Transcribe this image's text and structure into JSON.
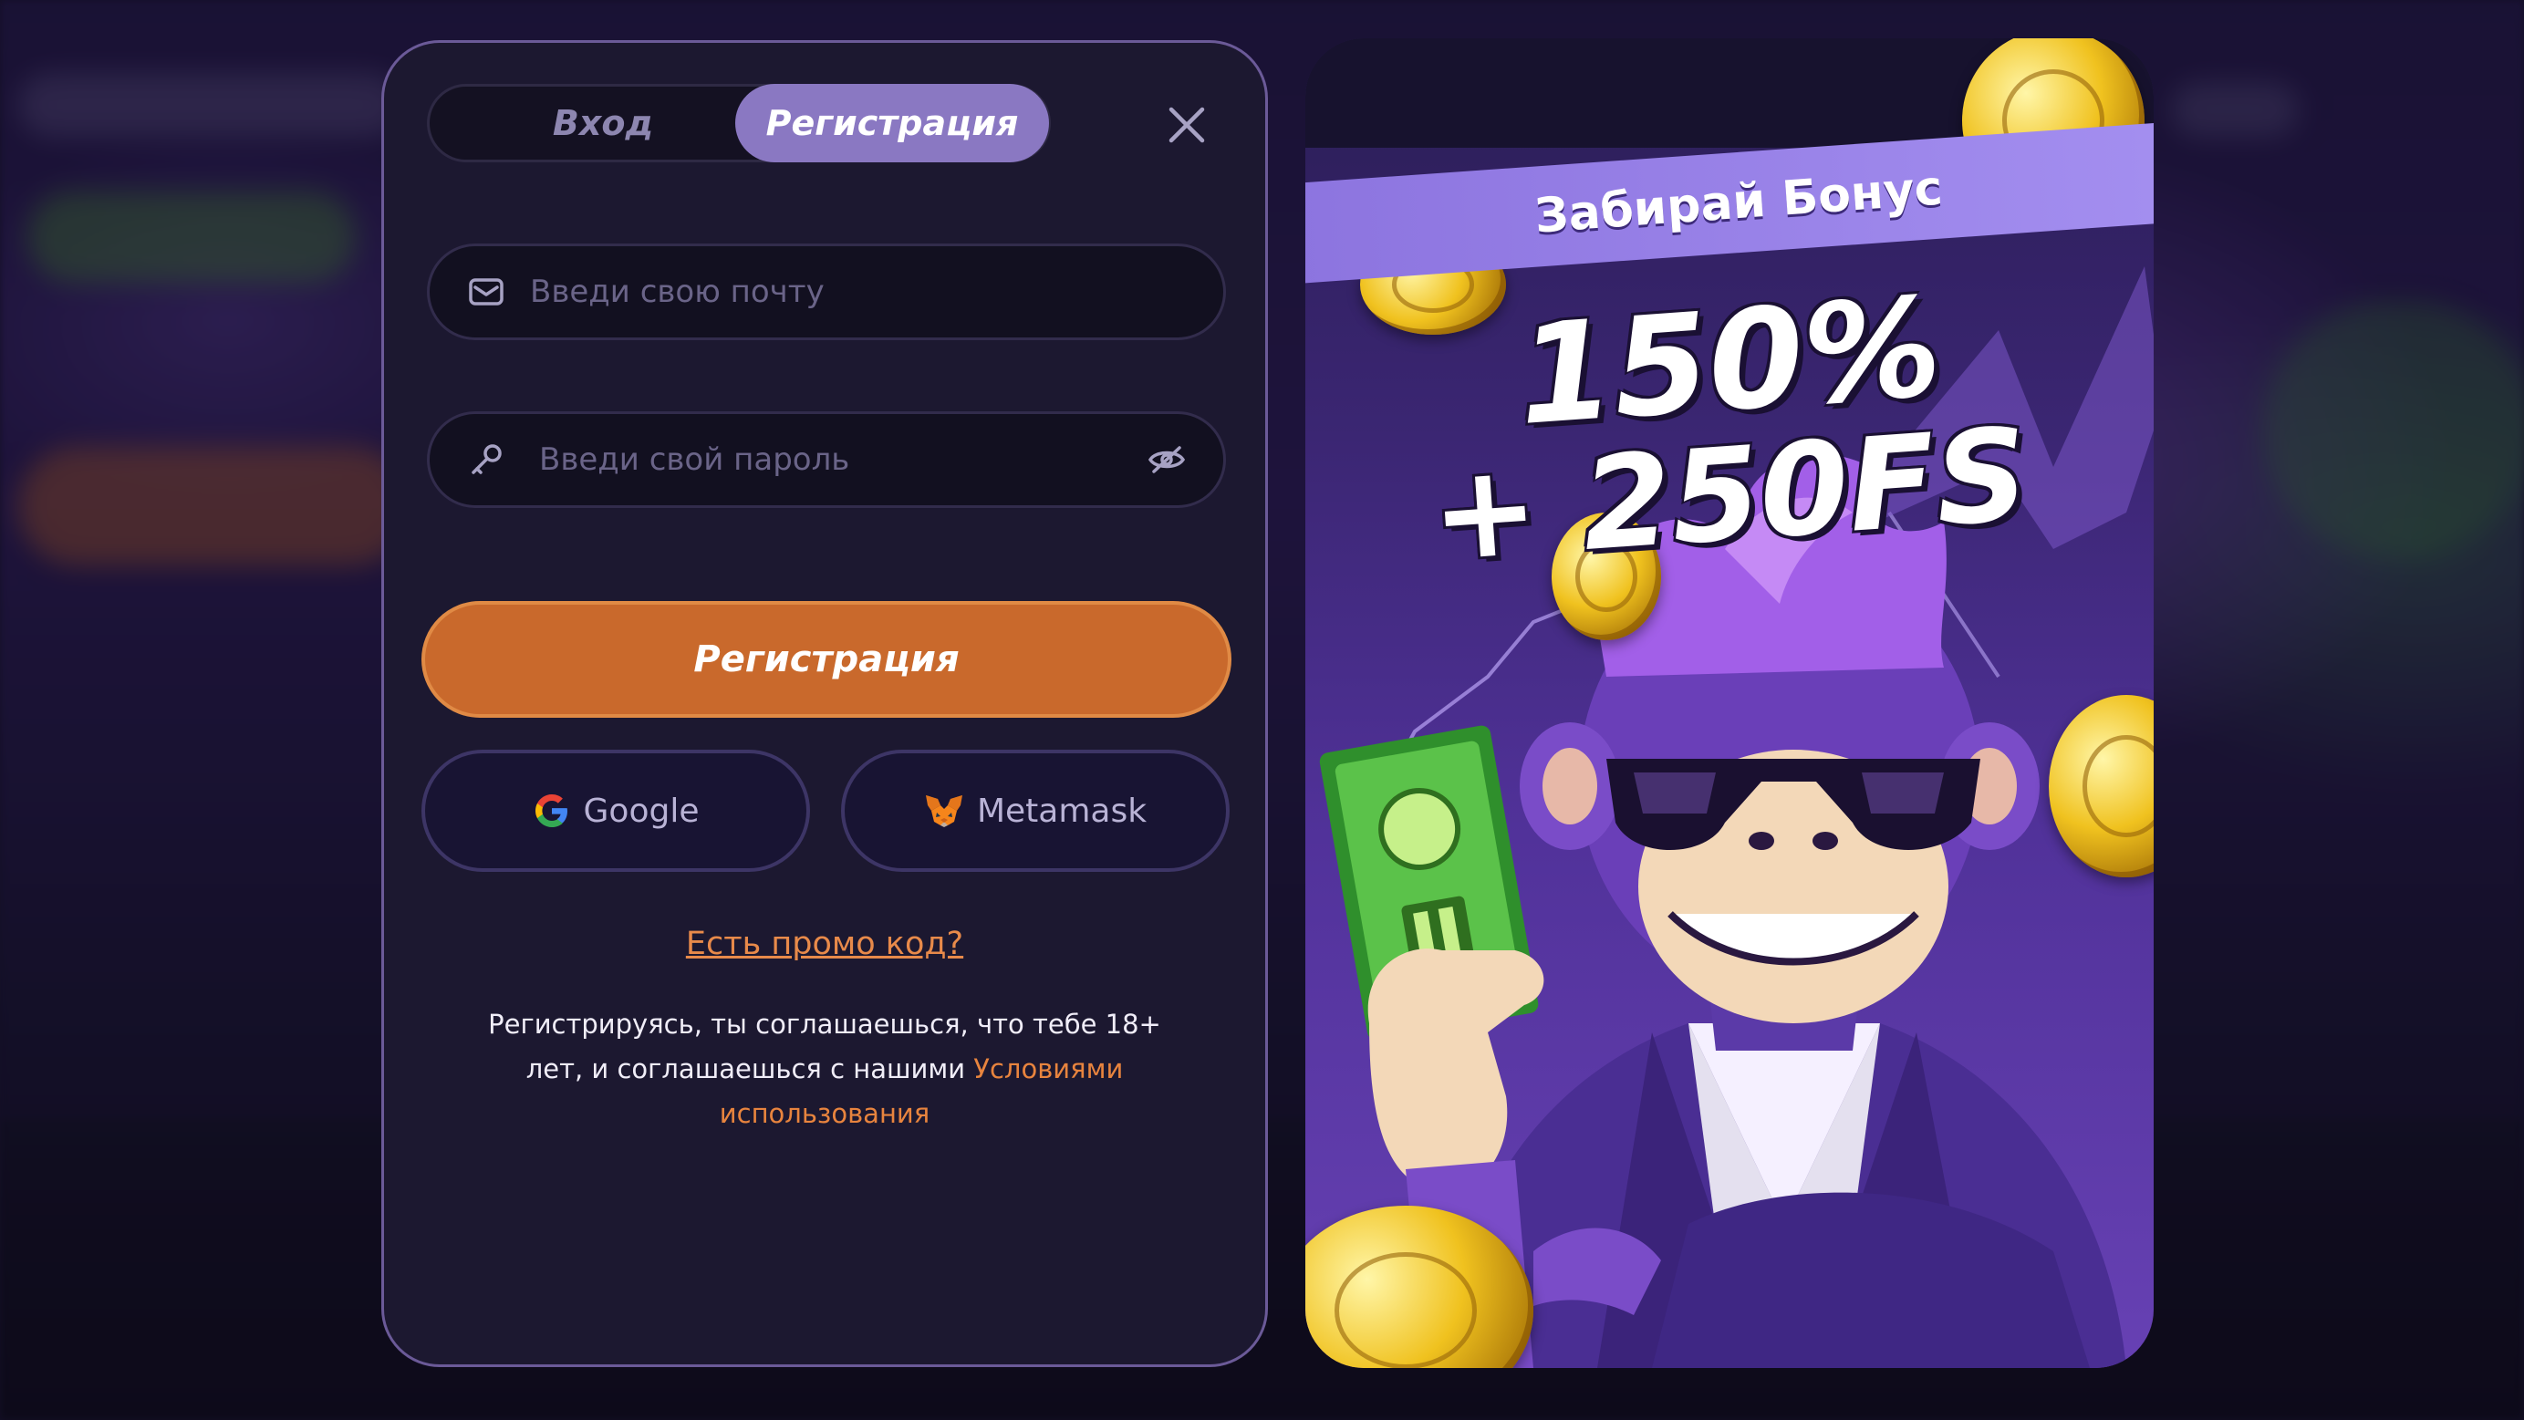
{
  "auth_modal": {
    "tabs": [
      {
        "label": "Вход",
        "active": false
      },
      {
        "label": "Регистрация",
        "active": true
      }
    ],
    "email": {
      "placeholder": "Введи свою почту",
      "value": ""
    },
    "password": {
      "placeholder": "Введи свой пароль",
      "value": ""
    },
    "submit_label": "Регистрация",
    "social": {
      "google_label": "Google",
      "metamask_label": "Metamask"
    },
    "promo_link": "Есть промо код?",
    "terms": {
      "text": "Регистрируясь, ты соглашаешься, что тебе 18+ лет, и соглашаешься с нашими ",
      "link": "Условиями использования"
    }
  },
  "promo_card": {
    "banner": "Забирай Бонус",
    "bonus_line_1": "150%",
    "bonus_line_2": "+ 250FS"
  },
  "colors": {
    "accent_orange": "#c9692c",
    "active_tab": "#8a78c2",
    "modal_bg": "#1c1830",
    "link_orange": "#e88a4a"
  },
  "icons": [
    "mail-icon",
    "key-icon",
    "eye-off-icon",
    "close-icon",
    "google-icon",
    "metamask-icon"
  ]
}
